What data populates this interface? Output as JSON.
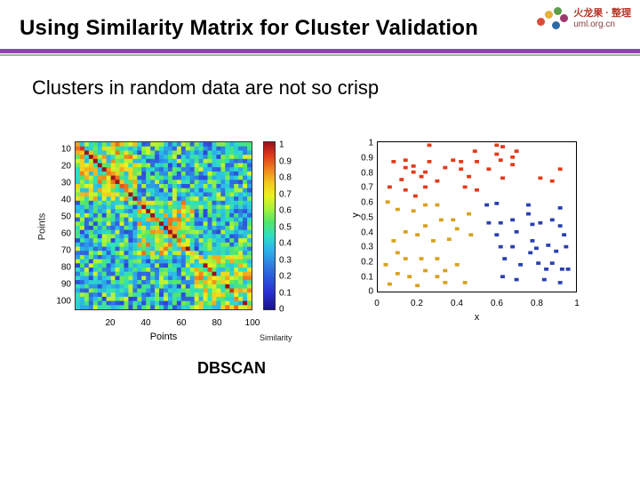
{
  "logo": {
    "line1": "火龙果 · 整理",
    "line2": "uml.org.cn"
  },
  "title": "Using Similarity Matrix for Cluster Validation",
  "subtitle": "Clusters in random data are not so crisp",
  "caption": "DBSCAN",
  "chart_data": [
    {
      "type": "heatmap",
      "title": "",
      "xlabel": "Points",
      "ylabel": "Points",
      "x_ticks": [
        20,
        40,
        60,
        80,
        100
      ],
      "y_ticks": [
        10,
        20,
        30,
        40,
        50,
        60,
        70,
        80,
        90,
        100
      ],
      "colorbar": {
        "label": "Similarity",
        "ticks": [
          0,
          0.1,
          0.2,
          0.3,
          0.4,
          0.5,
          0.6,
          0.7,
          0.8,
          0.9,
          1
        ]
      },
      "note": "100×100 noisy similarity matrix; no crisp block structure"
    },
    {
      "type": "scatter",
      "title": "",
      "xlabel": "x",
      "ylabel": "y",
      "xlim": [
        0,
        1
      ],
      "ylim": [
        0,
        1
      ],
      "x_ticks": [
        0,
        0.2,
        0.4,
        0.6,
        0.8,
        1
      ],
      "y_ticks": [
        0,
        0.1,
        0.2,
        0.3,
        0.4,
        0.5,
        0.6,
        0.7,
        0.8,
        0.9,
        1
      ],
      "series": [
        {
          "name": "cluster-red",
          "color": "#e23a1a",
          "points": [
            [
              0.26,
              0.98
            ],
            [
              0.6,
              0.98
            ],
            [
              0.63,
              0.97
            ],
            [
              0.49,
              0.94
            ],
            [
              0.6,
              0.92
            ],
            [
              0.08,
              0.87
            ],
            [
              0.14,
              0.88
            ],
            [
              0.14,
              0.83
            ],
            [
              0.18,
              0.84
            ],
            [
              0.18,
              0.8
            ],
            [
              0.24,
              0.8
            ],
            [
              0.22,
              0.77
            ],
            [
              0.12,
              0.75
            ],
            [
              0.06,
              0.7
            ],
            [
              0.14,
              0.68
            ],
            [
              0.19,
              0.64
            ],
            [
              0.24,
              0.7
            ],
            [
              0.26,
              0.87
            ],
            [
              0.34,
              0.83
            ],
            [
              0.3,
              0.74
            ],
            [
              0.38,
              0.88
            ],
            [
              0.42,
              0.87
            ],
            [
              0.42,
              0.82
            ],
            [
              0.46,
              0.77
            ],
            [
              0.5,
              0.87
            ],
            [
              0.56,
              0.82
            ],
            [
              0.62,
              0.88
            ],
            [
              0.63,
              0.76
            ],
            [
              0.68,
              0.9
            ],
            [
              0.68,
              0.85
            ],
            [
              0.7,
              0.94
            ],
            [
              0.44,
              0.7
            ],
            [
              0.5,
              0.68
            ],
            [
              0.82,
              0.76
            ],
            [
              0.88,
              0.74
            ],
            [
              0.92,
              0.82
            ]
          ]
        },
        {
          "name": "cluster-gold",
          "color": "#d6a21c",
          "points": [
            [
              0.05,
              0.6
            ],
            [
              0.1,
              0.55
            ],
            [
              0.18,
              0.54
            ],
            [
              0.24,
              0.58
            ],
            [
              0.3,
              0.58
            ],
            [
              0.24,
              0.44
            ],
            [
              0.32,
              0.48
            ],
            [
              0.38,
              0.48
            ],
            [
              0.4,
              0.42
            ],
            [
              0.46,
              0.52
            ],
            [
              0.47,
              0.38
            ],
            [
              0.2,
              0.38
            ],
            [
              0.28,
              0.34
            ],
            [
              0.36,
              0.35
            ],
            [
              0.08,
              0.34
            ],
            [
              0.1,
              0.26
            ],
            [
              0.14,
              0.22
            ],
            [
              0.22,
              0.22
            ],
            [
              0.3,
              0.22
            ],
            [
              0.24,
              0.14
            ],
            [
              0.04,
              0.18
            ],
            [
              0.1,
              0.12
            ],
            [
              0.16,
              0.1
            ],
            [
              0.3,
              0.1
            ],
            [
              0.34,
              0.14
            ],
            [
              0.4,
              0.18
            ],
            [
              0.06,
              0.05
            ],
            [
              0.2,
              0.04
            ],
            [
              0.34,
              0.06
            ],
            [
              0.44,
              0.06
            ],
            [
              0.14,
              0.4
            ]
          ]
        },
        {
          "name": "cluster-blue",
          "color": "#2a3fb0",
          "points": [
            [
              0.55,
              0.58
            ],
            [
              0.6,
              0.59
            ],
            [
              0.76,
              0.58
            ],
            [
              0.76,
              0.52
            ],
            [
              0.92,
              0.56
            ],
            [
              0.56,
              0.46
            ],
            [
              0.62,
              0.46
            ],
            [
              0.6,
              0.38
            ],
            [
              0.68,
              0.48
            ],
            [
              0.7,
              0.4
            ],
            [
              0.78,
              0.45
            ],
            [
              0.82,
              0.46
            ],
            [
              0.88,
              0.48
            ],
            [
              0.92,
              0.44
            ],
            [
              0.94,
              0.38
            ],
            [
              0.62,
              0.3
            ],
            [
              0.68,
              0.3
            ],
            [
              0.78,
              0.34
            ],
            [
              0.8,
              0.29
            ],
            [
              0.86,
              0.31
            ],
            [
              0.9,
              0.27
            ],
            [
              0.95,
              0.3
            ],
            [
              0.64,
              0.22
            ],
            [
              0.72,
              0.18
            ],
            [
              0.77,
              0.26
            ],
            [
              0.81,
              0.19
            ],
            [
              0.85,
              0.15
            ],
            [
              0.88,
              0.19
            ],
            [
              0.93,
              0.15
            ],
            [
              0.96,
              0.15
            ],
            [
              0.63,
              0.1
            ],
            [
              0.7,
              0.08
            ],
            [
              0.84,
              0.08
            ],
            [
              0.92,
              0.06
            ]
          ]
        }
      ]
    }
  ]
}
